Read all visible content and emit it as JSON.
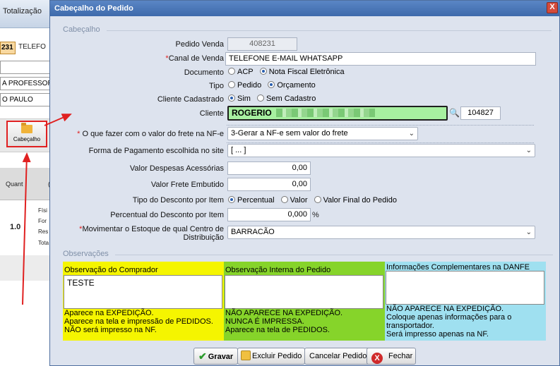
{
  "background": {
    "tab_label": "Totalização",
    "order_code": "231",
    "contact_field": "TELEFO",
    "field_row1": "A PROFESSOR",
    "field_row2": "O PAULO",
    "cabecalho_button": "Cabeçalho",
    "grid_col": "Quant",
    "grid_col2": "(",
    "qty_value": "1.0",
    "side_labels": [
      "Físi",
      "For",
      "Res",
      "Tota"
    ]
  },
  "dialog": {
    "title": "Cabeçalho do Pedido",
    "close_label": "X",
    "section_header": "Cabeçalho",
    "pedido_venda": {
      "label": "Pedido Venda",
      "value": "408231"
    },
    "canal_venda": {
      "label": "Canal de Venda",
      "value": "TELEFONE E-MAIL WHATSAPP",
      "required_mark": "*"
    },
    "documento": {
      "label": "Documento",
      "options": [
        "ACP",
        "Nota Fiscal Eletrônica"
      ],
      "selected": 1
    },
    "tipo": {
      "label": "Tipo",
      "options": [
        "Pedido",
        "Orçamento"
      ],
      "selected": 1
    },
    "cliente_cadastrado": {
      "label": "Cliente Cadastrado",
      "options": [
        "Sim",
        "Sem Cadastro"
      ],
      "selected": 0
    },
    "cliente": {
      "label": "Cliente",
      "name": "ROGERIO",
      "code": "104827",
      "highlight_color": "#a7f0a0"
    },
    "frete": {
      "label": "O que fazer com o valor do frete na NF-e",
      "required_mark": "*",
      "value": "3-Gerar a NF-e sem valor do frete"
    },
    "forma_pagamento": {
      "label": "Forma de Pagamento escolhida no site",
      "value": "[ ... ]"
    },
    "despesas": {
      "label": "Valor Despesas Acessórias",
      "value": "0,00"
    },
    "frete_embutido": {
      "label": "Valor Frete Embutido",
      "value": "0,00"
    },
    "tipo_desconto": {
      "label": "Tipo do Desconto por Item",
      "options": [
        "Percentual",
        "Valor",
        "Valor Final do Pedido"
      ],
      "selected": 0
    },
    "percentual_desconto": {
      "label": "Percentual do Desconto por Item",
      "value": "0,000",
      "unit": "%"
    },
    "estoque": {
      "label_line1": "Movimentar o Estoque de qual Centro de",
      "label_line2": "Distribuição",
      "required_mark": "*",
      "value": "BARRACÃO"
    },
    "observacoes_header": "Observações",
    "obs_comprador": {
      "title": "Observação do Comprador",
      "value": "TESTE",
      "notes": [
        "Aparece na EXPEDIÇÃO.",
        "Aparece na tela e impressão de PEDIDOS.",
        "NÃO será impresso na NF."
      ],
      "color": "#f5f500"
    },
    "obs_interna": {
      "title": "Observação Interna do Pedido",
      "value": "",
      "notes": [
        "NÃO APARECE NA EXPEDIÇÃO.",
        "NUNCA É IMPRESSA.",
        "Aparece na tela de PEDIDOS."
      ],
      "color": "#86d42a"
    },
    "obs_danfe": {
      "title": "Informações Complementares na DANFE",
      "value": "",
      "notes": [
        "NÃO APARECE NA EXPEDIÇÃO.",
        "Coloque apenas informações para o",
        "transportador.",
        "Será impresso apenas na NF."
      ],
      "color": "#9fe0f0"
    },
    "buttons": {
      "gravar": "Gravar",
      "excluir": "Excluir Pedido",
      "cancelar": "Cancelar Pedido",
      "fechar": "Fechar",
      "fechar_icon": "X"
    }
  },
  "colors": {
    "annotation_red": "#e02020",
    "title_blue": "#4a77b8"
  }
}
